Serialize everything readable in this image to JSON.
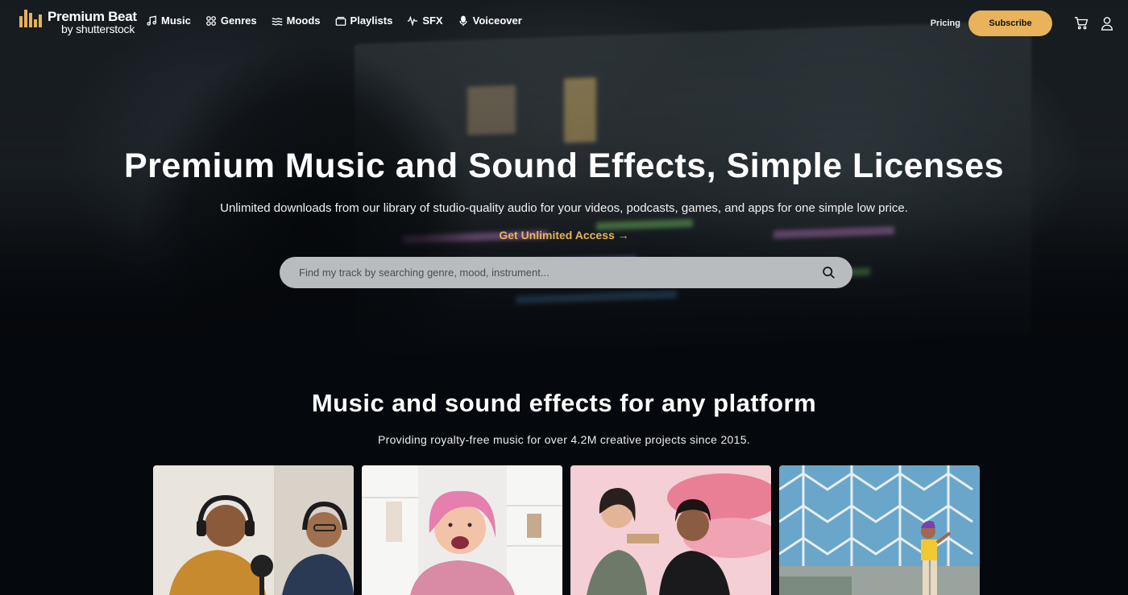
{
  "brand": {
    "name": "Premium Beat",
    "sub": "by shutterstock",
    "accent": "#e8b35a"
  },
  "nav": {
    "items": [
      {
        "label": "Music",
        "icon": "music-note-icon"
      },
      {
        "label": "Genres",
        "icon": "genres-grid-icon"
      },
      {
        "label": "Moods",
        "icon": "waves-icon"
      },
      {
        "label": "Playlists",
        "icon": "playlist-folder-icon"
      },
      {
        "label": "SFX",
        "icon": "waveform-icon"
      },
      {
        "label": "Voiceover",
        "icon": "microphone-icon"
      }
    ],
    "pricing": "Pricing",
    "subscribe": "Subscribe",
    "cart_icon": "cart-icon",
    "account_icon": "user-icon"
  },
  "hero": {
    "title": "Premium Music and Sound Effects, Simple Licenses",
    "subtitle": "Unlimited downloads from our library of studio-quality audio for your videos, podcasts, games, and apps for one simple low price.",
    "cta": "Get Unlimited Access",
    "cta_arrow": "→",
    "search_placeholder": "Find my track by searching genre, mood, instrument...",
    "search_icon": "search-icon"
  },
  "platform": {
    "title": "Music and sound effects for any platform",
    "subtitle": "Providing royalty-free music for over 4.2M creative projects since 2015.",
    "cards": [
      {
        "name": "podcast-card"
      },
      {
        "name": "creator-card"
      },
      {
        "name": "beauty-card"
      },
      {
        "name": "dance-card"
      }
    ]
  }
}
